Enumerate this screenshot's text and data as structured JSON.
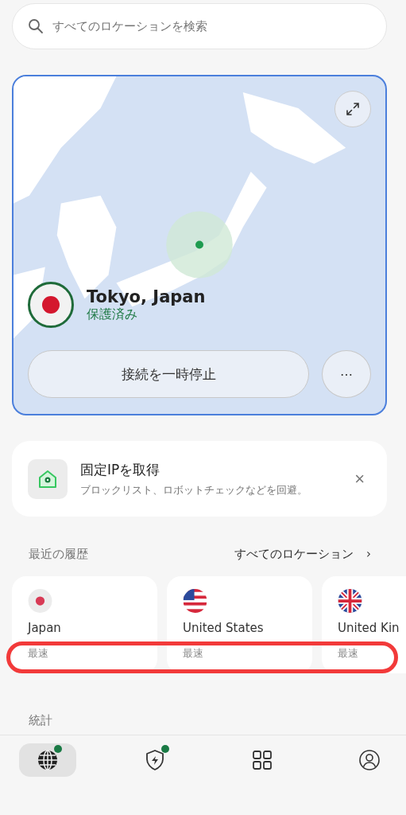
{
  "search": {
    "placeholder": "すべてのロケーションを検索"
  },
  "connection": {
    "location": "Tokyo, Japan",
    "status": "保護済み",
    "pause_button": "接続を一時停止",
    "more_button": "⋯"
  },
  "promo": {
    "title": "固定IPを取得",
    "subtitle": "ブロックリスト、ロボットチェックなどを回避。",
    "close": "×"
  },
  "recent": {
    "title": "最近の履歴",
    "link": "すべてのロケーション",
    "link_arrow": "›",
    "items": [
      {
        "kind": "jp",
        "name": "Japan",
        "tag": "最速"
      },
      {
        "kind": "us",
        "name": "United States",
        "tag": "最速"
      },
      {
        "kind": "gb",
        "name": "United Kin",
        "tag": "最速"
      }
    ]
  },
  "stats": {
    "title": "統計"
  },
  "nav": [
    {
      "kind": "globe",
      "selected": true,
      "badge": true
    },
    {
      "kind": "shield",
      "selected": false,
      "badge": true
    },
    {
      "kind": "grid",
      "selected": false,
      "badge": false
    },
    {
      "kind": "profile",
      "selected": false,
      "badge": false
    }
  ]
}
